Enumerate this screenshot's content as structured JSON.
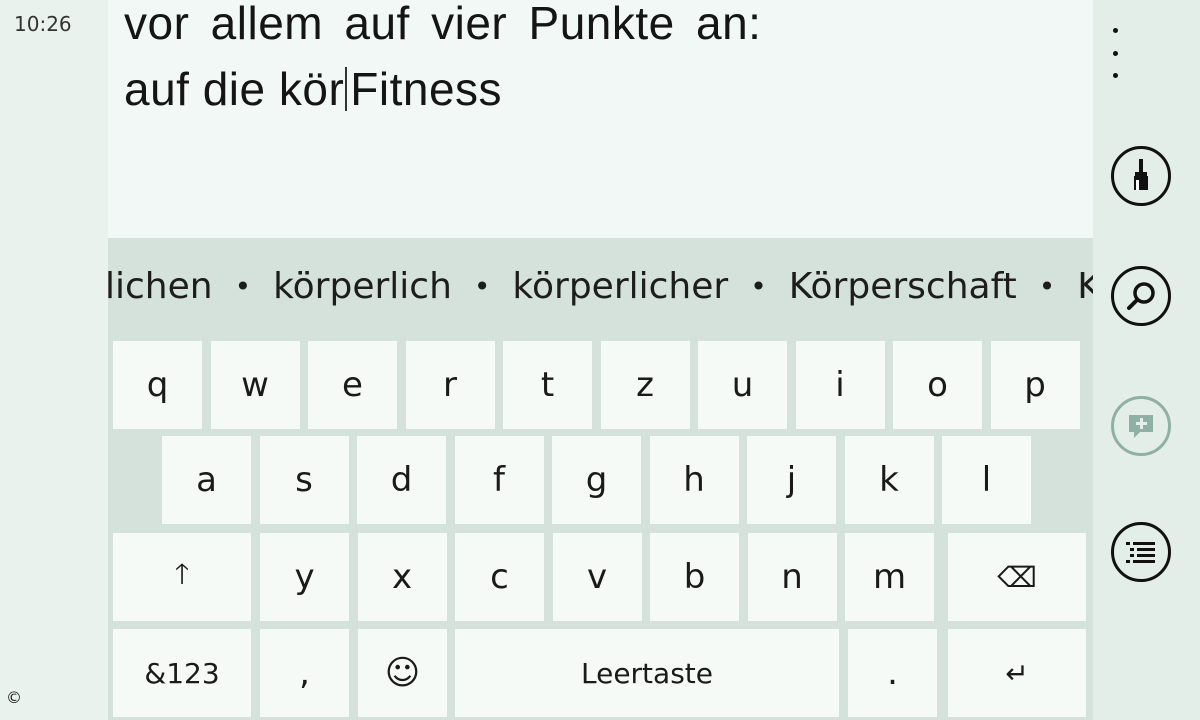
{
  "status": {
    "time": "10:26"
  },
  "watermark": "©",
  "document": {
    "line1": "vor allem auf vier Punkte an:",
    "line2_before_caret": "auf die kör",
    "line2_after_caret": "Fitness"
  },
  "suggestions": [
    "lichen",
    "körperlich",
    "körperlicher",
    "Körperschaft",
    "K"
  ],
  "suggestion_separator": "•",
  "keyboard": {
    "row1": [
      "q",
      "w",
      "e",
      "r",
      "t",
      "z",
      "u",
      "i",
      "o",
      "p"
    ],
    "row2": [
      "a",
      "s",
      "d",
      "f",
      "g",
      "h",
      "j",
      "k",
      "l"
    ],
    "row3": [
      "y",
      "x",
      "c",
      "v",
      "b",
      "n",
      "m"
    ],
    "shift_glyph": "🡑",
    "backspace_glyph": "⌫",
    "symbols_label": "&123",
    "comma_label": ",",
    "emoji_glyph": "☺",
    "space_label": "Leertaste",
    "period_label": ".",
    "enter_glyph": "↵"
  },
  "appbar": {
    "buttons": [
      "brush-icon",
      "search-icon",
      "add-comment-icon",
      "list-icon"
    ],
    "more_icon": "more-dots-icon"
  }
}
